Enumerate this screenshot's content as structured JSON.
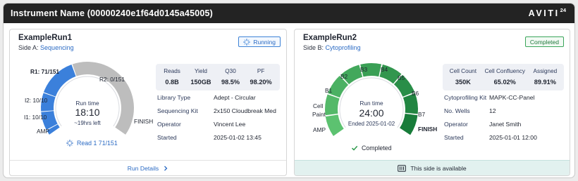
{
  "header": {
    "title": "Instrument Name (00000240e1f64d0145a45005)",
    "logo_word": "AVITI",
    "logo_num": "24"
  },
  "left": {
    "run_name": "ExampleRun1",
    "side_prefix": "Side A:",
    "side_link": "Sequencing",
    "status": "Running",
    "gauge": {
      "labels": {
        "r1": "R1: 71/151",
        "r2": "R2: 0/151",
        "i2": "I2: 10/10",
        "i1": "I1: 10/10",
        "amp": "AMP",
        "finish": "FINISH"
      },
      "center_label": "Run time",
      "center_time": "18:10",
      "center_sub": "~19hrs left",
      "progress": "Read 1 71/151",
      "fill_fraction": 0.42
    },
    "stats": [
      {
        "label": "Reads",
        "value": "0.8B"
      },
      {
        "label": "Yield",
        "value": "150GB"
      },
      {
        "label": "Q30",
        "value": "98.5%"
      },
      {
        "label": "PF",
        "value": "98.20%"
      }
    ],
    "props": [
      {
        "key": "Library Type",
        "value": "Adept - Circular"
      },
      {
        "key": "Sequencing Kit",
        "value": "2x150 Cloudbreak Med"
      },
      {
        "key": "Operator",
        "value": "Vincent Lee"
      },
      {
        "key": "Started",
        "value": "2025-01-02 13:45"
      }
    ],
    "footer_link": "Run Details",
    "colors": {
      "blue": "#3b80db",
      "gray": "#bdbdbd"
    }
  },
  "right": {
    "run_name": "ExampleRun2",
    "side_prefix": "Side B:",
    "side_link": "Cytoprofiling",
    "status": "Completed",
    "gauge": {
      "labels": {
        "amp": "AMP",
        "cell_paint_1": "Cell",
        "cell_paint_2": "Paint",
        "b1": "B1",
        "b2": "B2",
        "b3": "B3",
        "b4": "B4",
        "b5": "B5",
        "b6": "B6",
        "b7": "B7",
        "finish": "FINISH"
      },
      "center_label": "Run time",
      "center_time": "24:00",
      "center_sub": "Ended 2025-01-02",
      "status_text": "Completed"
    },
    "stats": [
      {
        "label": "Cell Count",
        "value": "350K"
      },
      {
        "label": "Cell Confluency",
        "value": "65.02%"
      },
      {
        "label": "Assigned",
        "value": "89.91%"
      }
    ],
    "props": [
      {
        "key": "Cytoprofiling Kit",
        "value": "MAPK-CC-Panel"
      },
      {
        "key": "No. Wells",
        "value": "12"
      },
      {
        "key": "Operator",
        "value": "Janet Smith"
      },
      {
        "key": "Started",
        "value": "2025-01-01 12:00"
      }
    ],
    "footer_text": "This side is available",
    "colors": {
      "green_light": "#5cc270",
      "green_dark": "#187c3a"
    }
  }
}
